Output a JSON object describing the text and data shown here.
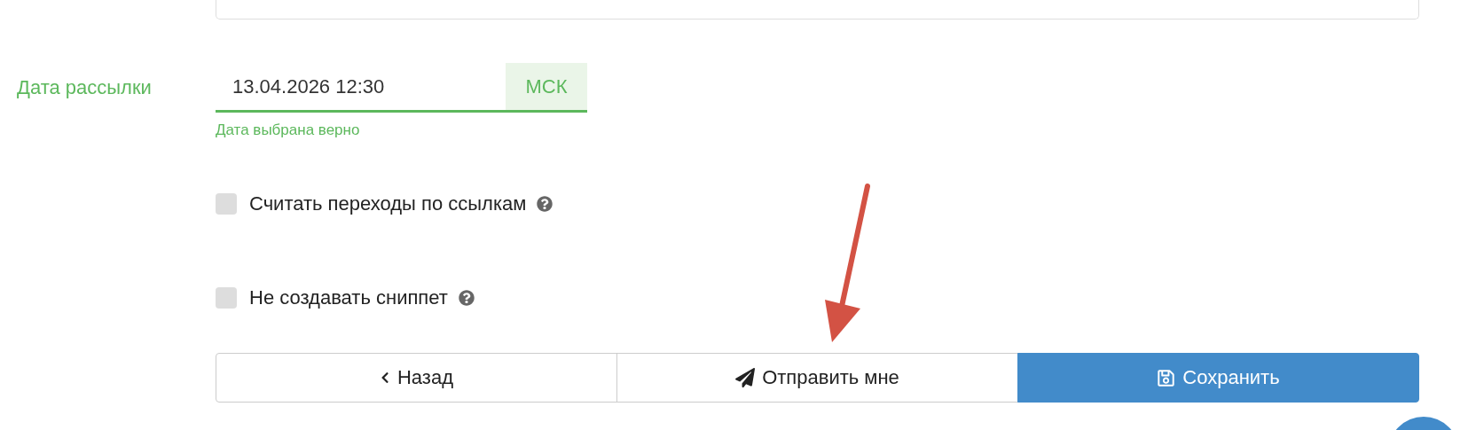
{
  "date_field": {
    "label": "Дата рассылки",
    "value": "13.04.2026 12:30",
    "addon": "МСК",
    "hint": "Дата выбрана верно",
    "valid": true
  },
  "options": [
    {
      "label": "Считать переходы по ссылкам",
      "checked": false
    },
    {
      "label": "Не создавать сниппет",
      "checked": false
    }
  ],
  "buttons": [
    {
      "kind": "back",
      "label": "Назад"
    },
    {
      "kind": "send",
      "label": "Отправить мне"
    },
    {
      "kind": "save",
      "label": "Сохранить"
    }
  ]
}
